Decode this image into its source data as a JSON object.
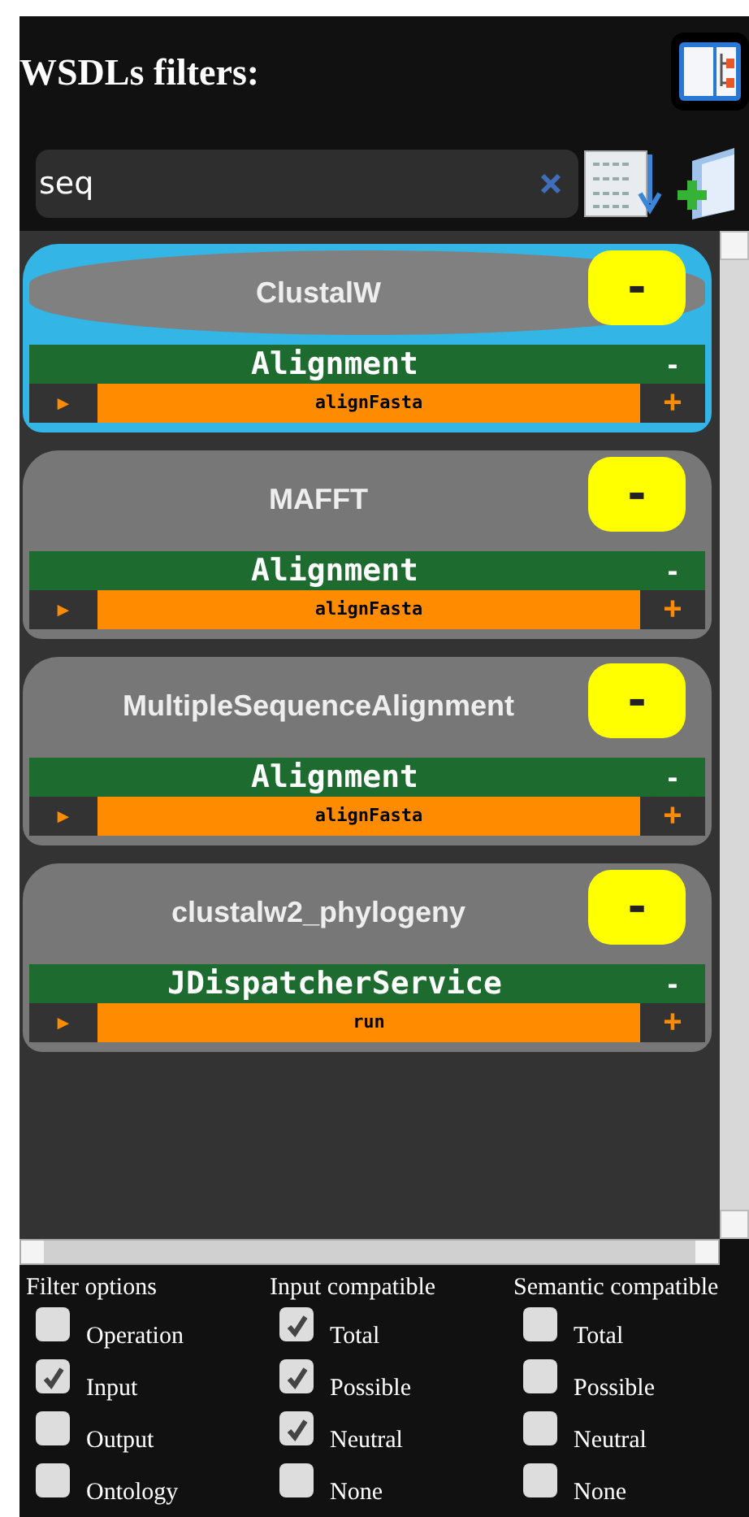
{
  "header": {
    "title": "WSDLs filters:"
  },
  "search": {
    "value": "seq"
  },
  "services": [
    {
      "name": "ClustalW",
      "selected": true,
      "button": "-",
      "interfaces": [
        {
          "name": "Alignment",
          "toggle": "-",
          "operations": [
            {
              "arrow": "►",
              "name": "alignFasta",
              "add": "+"
            }
          ]
        }
      ]
    },
    {
      "name": "MAFFT",
      "selected": false,
      "button": "-",
      "interfaces": [
        {
          "name": "Alignment",
          "toggle": "-",
          "operations": [
            {
              "arrow": "►",
              "name": "alignFasta",
              "add": "+"
            }
          ]
        }
      ]
    },
    {
      "name": "MultipleSequenceAlignment",
      "selected": false,
      "button": "-",
      "interfaces": [
        {
          "name": "Alignment",
          "toggle": "-",
          "operations": [
            {
              "arrow": "►",
              "name": "alignFasta",
              "add": "+"
            }
          ]
        }
      ]
    },
    {
      "name": "clustalw2_phylogeny",
      "selected": false,
      "button": "-",
      "interfaces": [
        {
          "name": "JDispatcherService",
          "toggle": "-",
          "operations": [
            {
              "arrow": "►",
              "name": "run",
              "add": "+"
            }
          ]
        }
      ]
    }
  ],
  "filters": [
    {
      "heading": "Filter options",
      "options": [
        {
          "label": "Operation",
          "checked": false
        },
        {
          "label": "Input",
          "checked": true
        },
        {
          "label": "Output",
          "checked": false
        },
        {
          "label": "Ontology",
          "checked": false
        }
      ]
    },
    {
      "heading": "Input compatible",
      "options": [
        {
          "label": "Total",
          "checked": true
        },
        {
          "label": "Possible",
          "checked": true
        },
        {
          "label": "Neutral",
          "checked": true
        },
        {
          "label": "None",
          "checked": false
        }
      ]
    },
    {
      "heading": "Semantic compatible",
      "options": [
        {
          "label": "Total",
          "checked": false
        },
        {
          "label": "Possible",
          "checked": false
        },
        {
          "label": "Neutral",
          "checked": false
        },
        {
          "label": "None",
          "checked": false
        }
      ]
    }
  ]
}
